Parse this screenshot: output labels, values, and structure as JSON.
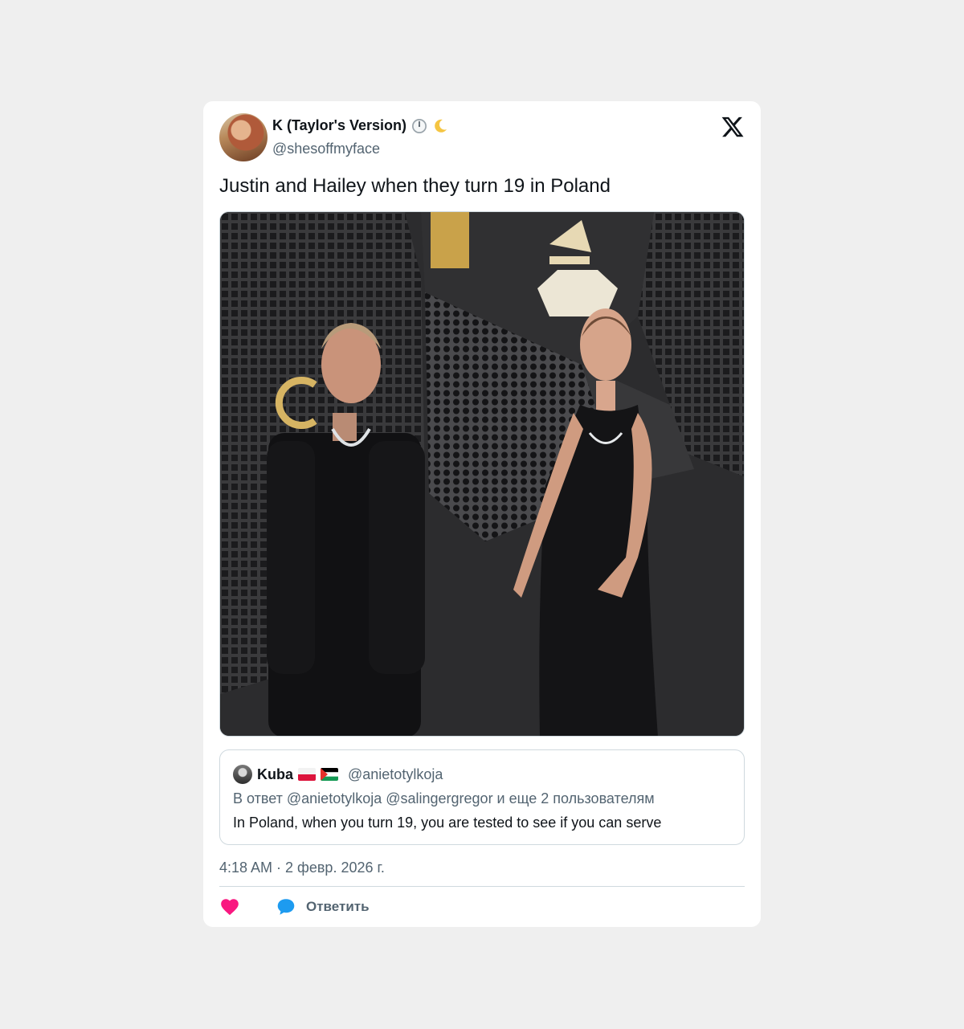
{
  "tweet": {
    "author": {
      "display_name": "K (Taylor's Version)",
      "handle": "@shesoffmyface",
      "emoji": [
        "clock-icon",
        "moon-icon"
      ]
    },
    "text": "Justin and Hailey when they turn 19 in Poland",
    "media": {
      "icon": "photo"
    },
    "quoted": {
      "author": {
        "display_name": "Kuba",
        "flags": [
          "poland-flag",
          "palestine-flag"
        ],
        "handle": "@anietotylkoja"
      },
      "reply_context": "В ответ @anietotylkoja @salingergregor  и еще 2 пользователям",
      "text": "In Poland, when you turn 19, you are tested to see if you can serve"
    },
    "timestamp": "4:18 AM · 2 февр. 2026 г.",
    "actions": {
      "like_icon": "heart-icon",
      "reply_icon": "speech-bubble-icon",
      "reply_label": "Ответить"
    }
  },
  "colors": {
    "like": "#f91880",
    "reply": "#1d9bf0",
    "text_primary": "#0f1419",
    "text_secondary": "#536471",
    "border": "#cfd9de"
  }
}
